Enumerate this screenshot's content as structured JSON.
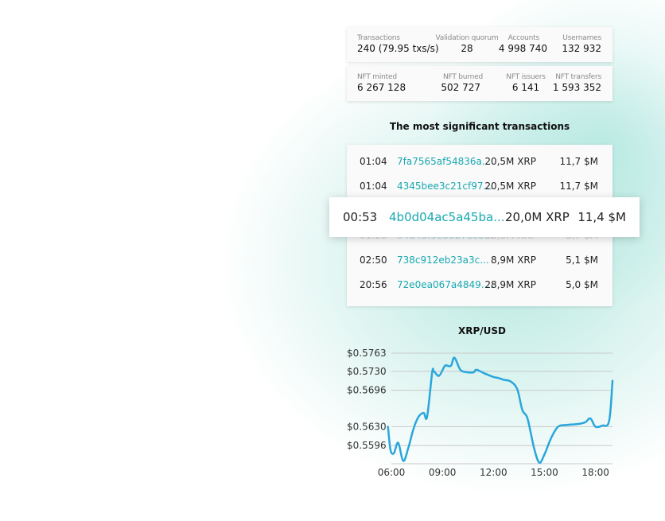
{
  "stats_row1": {
    "transactions": {
      "label": "Transactions",
      "value": "240 (79.95 txs/s)"
    },
    "validation_quorum": {
      "label": "Validation quorum",
      "value": "28"
    },
    "accounts": {
      "label": "Accounts",
      "value": "4 998 740"
    },
    "usernames": {
      "label": "Usernames",
      "value": "132 932"
    }
  },
  "stats_row2": {
    "nft_minted": {
      "label": "NFT minted",
      "value": "6 267 128"
    },
    "nft_burned": {
      "label": "NFT burned",
      "value": "502 727"
    },
    "nft_issuers": {
      "label": "NFT issuers",
      "value": "6 141"
    },
    "nft_transfers": {
      "label": "NFT transfers",
      "value": "1 593 352"
    }
  },
  "transactions_title": "The most significant transactions",
  "transactions": [
    {
      "time": "01:04",
      "hash": "7fa7565af54836a...",
      "amount": "20,5M XRP",
      "usd": "11,7 $M"
    },
    {
      "time": "01:04",
      "hash": "4345bee3c21cf97...",
      "amount": "20,5M XRP",
      "usd": "11,7 $M"
    },
    {
      "time": "01:28",
      "hash": "94d45f5e86b7ec8...",
      "amount": "10,3M XRP",
      "usd": "5,7 $M"
    },
    {
      "time": "02:50",
      "hash": "738c912eb23a3c...",
      "amount": "8,9M XRP",
      "usd": "5,1 $M"
    },
    {
      "time": "20:56",
      "hash": "72e0ea067a4849....",
      "amount": "28,9M XRP",
      "usd": "5,0 $M"
    }
  ],
  "highlighted_transaction": {
    "time": "00:53",
    "hash": "4b0d04ac5a45ba...",
    "amount": "20,0M XRP",
    "usd": "11,4 $M"
  },
  "colors": {
    "accent": "#18a8b0",
    "line": "#2aa6dc",
    "gradient": "#7ed6c8"
  },
  "chart_data": {
    "type": "line",
    "title": "XRP/USD",
    "y_ticks": [
      "$0.5763",
      "$0.5730",
      "$0.5696",
      "$0.5630",
      "$0.5596"
    ],
    "y_tick_values": [
      0.5763,
      0.573,
      0.5696,
      0.563,
      0.5596
    ],
    "x_ticks": [
      "06:00",
      "09:00",
      "12:00",
      "15:00",
      "18:00"
    ],
    "x_tick_values": [
      6,
      9,
      12,
      15,
      18
    ],
    "xlim": [
      6,
      19
    ],
    "ylim": [
      0.5563,
      0.5763
    ],
    "grid": true,
    "series": [
      {
        "x": [
          5.8,
          5.95,
          6.15,
          6.4,
          6.7,
          7.0,
          7.3,
          7.6,
          7.9,
          8.1,
          8.4,
          8.5,
          8.8,
          9.1,
          9.2,
          9.5,
          9.7,
          10.0,
          10.2,
          10.8,
          11.0,
          11.5,
          12.0,
          12.3,
          12.6,
          13.0,
          13.4,
          13.7,
          14.0,
          14.4,
          14.7,
          15.0,
          15.4,
          15.8,
          16.3,
          17.0,
          17.4,
          17.7,
          18.0,
          18.4,
          18.8,
          19.0
        ],
        "y": [
          0.563,
          0.5588,
          0.5582,
          0.5601,
          0.5568,
          0.5592,
          0.5626,
          0.5648,
          0.5655,
          0.5648,
          0.5728,
          0.573,
          0.5722,
          0.5738,
          0.5741,
          0.574,
          0.5755,
          0.5736,
          0.573,
          0.5728,
          0.5733,
          0.5726,
          0.572,
          0.5718,
          0.5715,
          0.5712,
          0.5698,
          0.566,
          0.5645,
          0.559,
          0.5565,
          0.558,
          0.561,
          0.563,
          0.5633,
          0.5635,
          0.5638,
          0.5645,
          0.563,
          0.5632,
          0.564,
          0.5713
        ]
      }
    ]
  }
}
